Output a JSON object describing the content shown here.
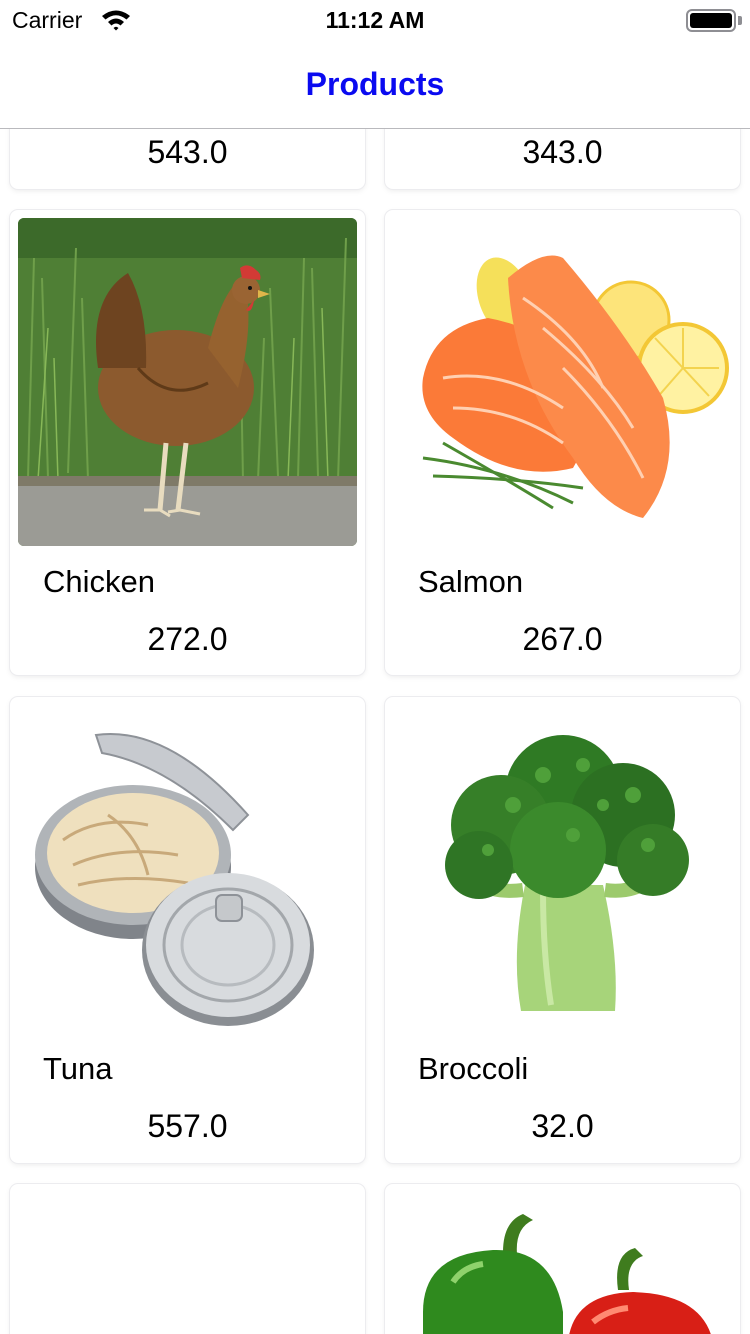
{
  "status_bar": {
    "carrier": "Carrier",
    "time": "11:12 AM",
    "wifi_icon": "wifi-icon",
    "battery_icon": "battery-icon"
  },
  "nav": {
    "title": "Products",
    "title_color": "#0a0af0"
  },
  "products_partial_top": [
    {
      "price": "543.0"
    },
    {
      "price": "343.0"
    }
  ],
  "products": [
    {
      "name": "Chicken",
      "price": "272.0",
      "image": "chicken-image"
    },
    {
      "name": "Salmon",
      "price": "267.0",
      "image": "salmon-image"
    },
    {
      "name": "Tuna",
      "price": "557.0",
      "image": "tuna-can-image"
    },
    {
      "name": "Broccoli",
      "price": "32.0",
      "image": "broccoli-image"
    }
  ],
  "products_partial_bottom": [
    {
      "image": "bacon-image"
    },
    {
      "image": "bell-peppers-image"
    }
  ]
}
